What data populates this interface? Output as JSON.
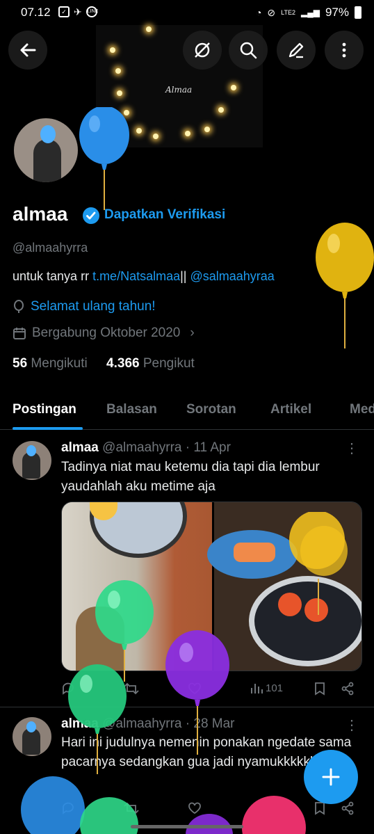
{
  "status_bar": {
    "time": "07.12",
    "battery": "97%",
    "network": "LTE2"
  },
  "banner": {
    "text": "Almaa"
  },
  "profile": {
    "display_name": "almaa",
    "verify_cta": "Dapatkan Verifikasi",
    "handle": "@almaahyrra",
    "bio_prefix": "untuk tanya rr ",
    "bio_link": "t.me/Natsalmaa",
    "bio_sep": "|| ",
    "bio_mention": "@salmaahyraa",
    "birthday": "Selamat ulang tahun!",
    "joined": "Bergabung Oktober 2020",
    "following_count": "56",
    "following_label": "Mengikuti",
    "followers_count": "4.366",
    "followers_label": "Pengikut"
  },
  "tabs": [
    "Postingan",
    "Balasan",
    "Sorotan",
    "Artikel",
    "Media"
  ],
  "posts": [
    {
      "name": "almaa",
      "handle": "@almaahyrra",
      "date": "11 Apr",
      "text": "Tadinya niat mau ketemu dia tapi dia lembur yaudahlah aku metime aja",
      "views": "101"
    },
    {
      "name": "almaa",
      "handle": "@almaahyrra",
      "date": "28 Mar",
      "text": "Hari ini judulnya nemenin ponakan ngedate sama pacarnya sedangkan gua jadi nyamukkkkkk"
    }
  ],
  "colors": {
    "accent": "#1d9bf0",
    "background": "#000000",
    "muted": "#71767b"
  }
}
